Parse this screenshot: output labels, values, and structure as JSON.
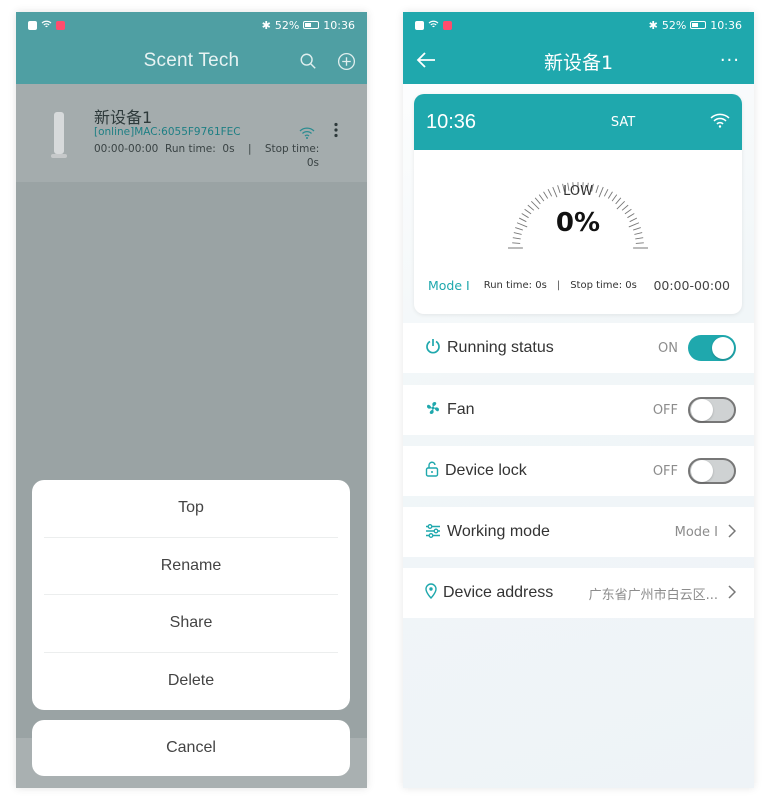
{
  "status_bar": {
    "battery": "52%",
    "time": "10:36"
  },
  "left_screen": {
    "app_title": "Scent Tech",
    "device": {
      "name": "新设备1",
      "status_mac": "[online]MAC:6055F9761FEC",
      "schedule": "00:00-00:00",
      "run_label": "Run time:",
      "run_value": "0s",
      "separator": "|",
      "stop_label": "Stop time:",
      "stop_value": "0s"
    },
    "action_sheet": {
      "items": [
        "Top",
        "Rename",
        "Share",
        "Delete"
      ],
      "cancel": "Cancel"
    }
  },
  "right_screen": {
    "title": "新设备1",
    "more": "···",
    "clock": {
      "time": "10:36",
      "day": "SAT",
      "level": "LOW",
      "percent": "0%",
      "mode": "Mode I",
      "run_label": "Run time:",
      "run_value": "0s",
      "separator": "|",
      "stop_label": "Stop time:",
      "stop_value": "0s",
      "range": "00:00-00:00"
    },
    "rows": {
      "running": {
        "label": "Running status",
        "state": "ON"
      },
      "fan": {
        "label": "Fan",
        "state": "OFF"
      },
      "lock": {
        "label": "Device lock",
        "state": "OFF"
      },
      "mode": {
        "label": "Working mode",
        "value": "Mode I"
      },
      "address": {
        "label": "Device address",
        "value": "广东省广州市白云区..."
      }
    }
  },
  "colors": {
    "teal": "#1fa8ad",
    "left_header": "#4f9fa3",
    "overlay": "#9aa3a4"
  },
  "icons": [
    "search-icon",
    "add-circle-icon",
    "wifi-icon",
    "more-vertical-icon",
    "back-arrow-icon",
    "power-icon",
    "fan-icon",
    "unlock-icon",
    "sliders-icon",
    "location-pin-icon",
    "chevron-right-icon"
  ]
}
